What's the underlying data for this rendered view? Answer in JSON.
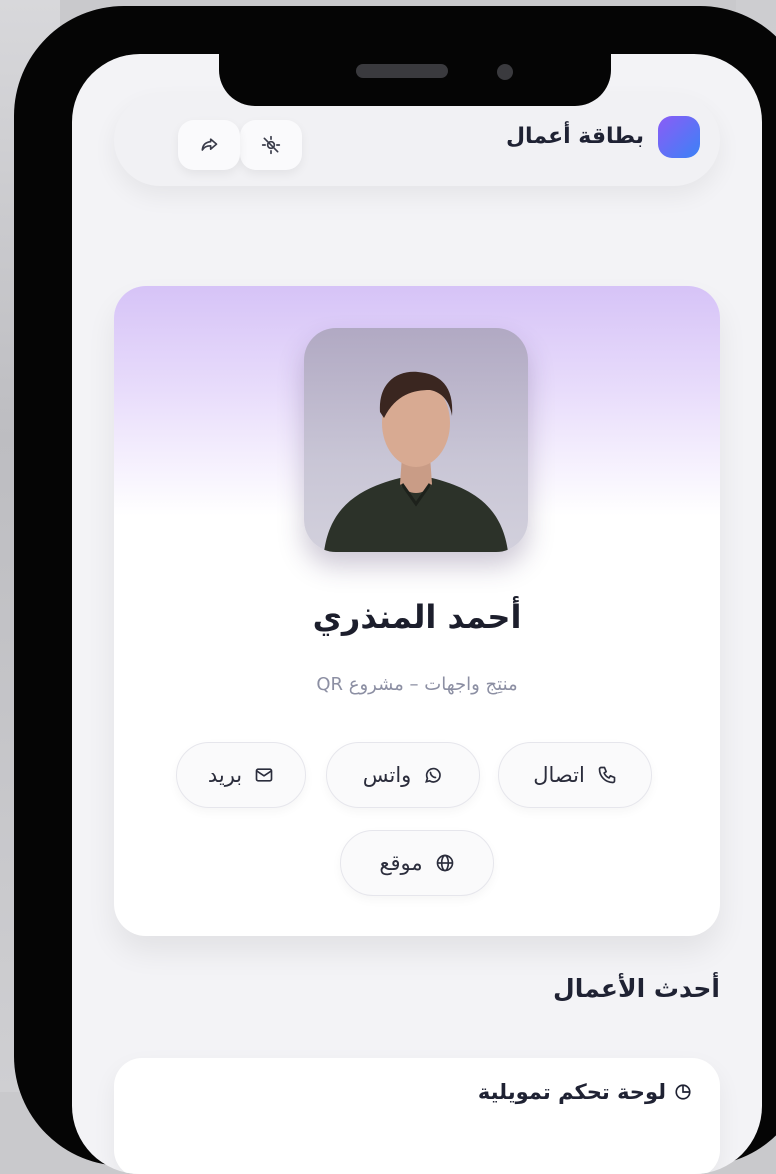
{
  "header": {
    "title": "بطاقة أعمال",
    "share_icon": "share-icon",
    "theme_icon": "theme-toggle-icon"
  },
  "profile": {
    "name": "أحمد المنذري",
    "role": "منتِج واجهات – مشروع QR"
  },
  "actions": [
    {
      "label": "اتصال",
      "icon": "phone-icon"
    },
    {
      "label": "واتس",
      "icon": "whatsapp-icon"
    },
    {
      "label": "بريد",
      "icon": "mail-icon"
    },
    {
      "label": "موقع",
      "icon": "globe-icon"
    }
  ],
  "works": {
    "section_title": "أحدث الأعمال",
    "items": [
      {
        "title": "لوحة تحكم تمويلية",
        "icon": "chart-icon"
      }
    ]
  },
  "colors": {
    "accent_purple": "#8b5cf6",
    "accent_blue": "#3b82f6",
    "glow": "#d6c3f7"
  }
}
